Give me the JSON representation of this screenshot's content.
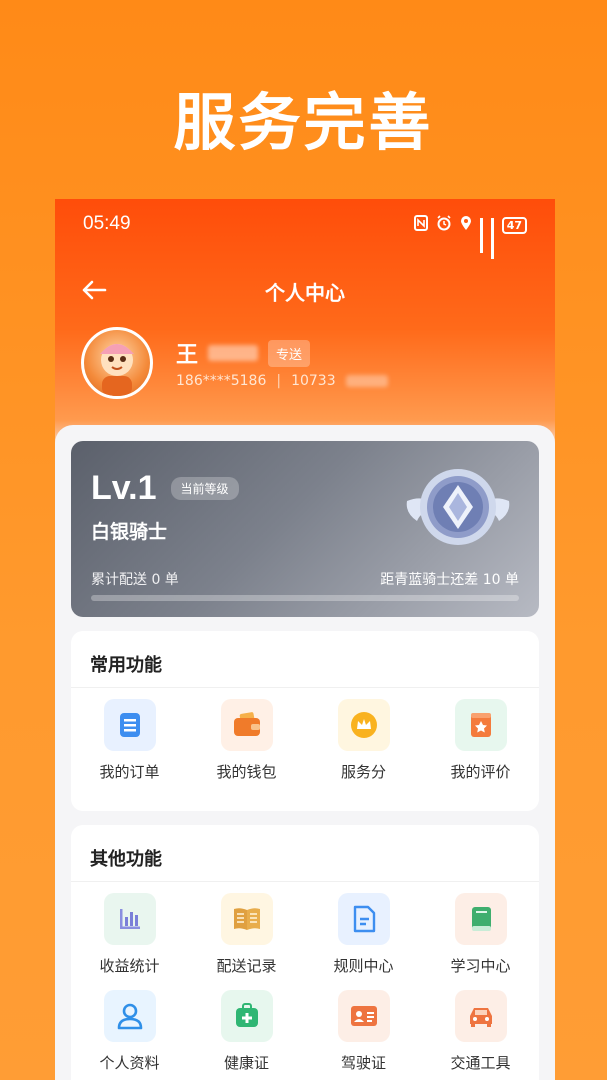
{
  "headline": "服务完善",
  "status_bar": {
    "time": "05:49",
    "battery": "47"
  },
  "header": {
    "title": "个人中心"
  },
  "profile": {
    "name": "王",
    "tag": "专送",
    "phone": "186****5186",
    "id_partial": "10733"
  },
  "level_card": {
    "level": "Lv.1",
    "badge": "当前等级",
    "rank_name": "白银骑士",
    "delivered": "累计配送 0 单",
    "next_rank_gap": "距青蓝骑士还差 10 单",
    "progress": 0
  },
  "common_functions": {
    "title": "常用功能",
    "items": [
      {
        "label": "我的订单",
        "icon": "order-list-icon"
      },
      {
        "label": "我的钱包",
        "icon": "wallet-icon"
      },
      {
        "label": "服务分",
        "icon": "crown-icon"
      },
      {
        "label": "我的评价",
        "icon": "review-star-icon"
      }
    ]
  },
  "other_functions": {
    "title": "其他功能",
    "items": [
      {
        "label": "收益统计",
        "icon": "bar-chart-icon"
      },
      {
        "label": "配送记录",
        "icon": "book-record-icon"
      },
      {
        "label": "规则中心",
        "icon": "document-icon"
      },
      {
        "label": "学习中心",
        "icon": "study-book-icon"
      },
      {
        "label": "个人资料",
        "icon": "person-icon"
      },
      {
        "label": "健康证",
        "icon": "health-kit-icon"
      },
      {
        "label": "驾驶证",
        "icon": "id-card-icon"
      },
      {
        "label": "交通工具",
        "icon": "car-icon"
      }
    ]
  },
  "colors": {
    "brand_orange": "#ff8a17",
    "header_red_orange": "#ff4d0a"
  }
}
